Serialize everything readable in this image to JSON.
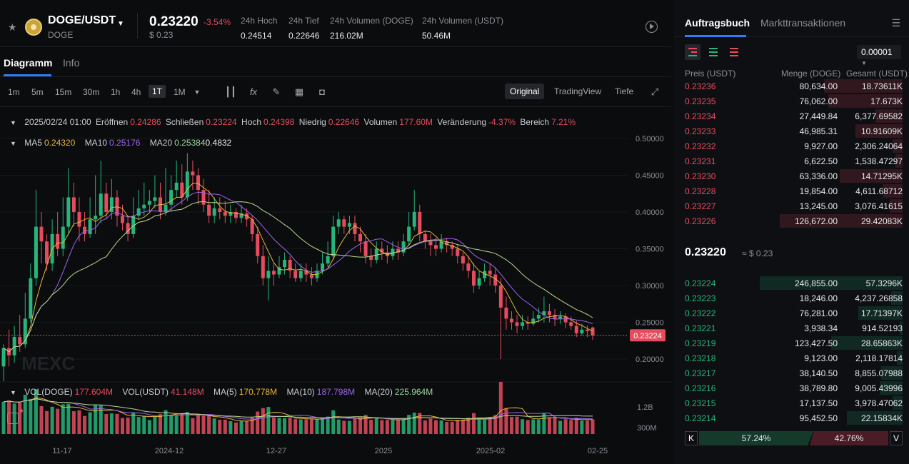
{
  "header": {
    "pair": "DOGE/USDT",
    "base": "DOGE",
    "price": "0.23220",
    "change": "-3.54%",
    "price_usd": "$ 0.23",
    "stats": [
      {
        "label": "24h Hoch",
        "value": "0.24514"
      },
      {
        "label": "24h Tief",
        "value": "0.22646"
      },
      {
        "label": "24h Volumen (DOGE)",
        "value": "216.02M"
      },
      {
        "label": "24h Volumen (USDT)",
        "value": "50.46M"
      }
    ]
  },
  "tabs": [
    {
      "label": "Diagramm"
    },
    {
      "label": "Info"
    }
  ],
  "toolbar": {
    "timeframes": [
      "1m",
      "5m",
      "15m",
      "30m",
      "1h",
      "4h",
      "1T",
      "1M"
    ],
    "active_timeframe": "1T",
    "views": [
      "Original",
      "TradingView",
      "Tiefe"
    ]
  },
  "ohlc": {
    "date": "2025/02/24 01:00",
    "open_label": "Eröffnen",
    "open": "0.24286",
    "close_label": "Schließen",
    "close": "0.23224",
    "high_label": "Hoch",
    "high": "0.24398",
    "low_label": "Niedrig",
    "low": "0.22646",
    "volume_label": "Volumen",
    "volume": "177.60M",
    "change_label": "Veränderung",
    "change": "-4.37%",
    "range_label": "Bereich",
    "range": "7.21%"
  },
  "ma": {
    "ma5_label": "MA5",
    "ma5": "0.24320",
    "ma10_label": "MA10",
    "ma10": "0.25176",
    "ma20_label": "MA20",
    "ma20": "0.25384",
    "overlap": "0.4832"
  },
  "vol": {
    "doge_label": "VOL(DOGE)",
    "doge": "177.604M",
    "usdt_label": "VOL(USDT)",
    "usdt": "41.148M",
    "ma5_label": "MA(5)",
    "ma5": "170.778M",
    "ma10_label": "MA(10)",
    "ma10": "187.798M",
    "ma20_label": "MA(20)",
    "ma20": "225.964M"
  },
  "chart_data": {
    "type": "candlestick",
    "y_ticks": [
      "0.50000",
      "0.45000",
      "0.40000",
      "0.35000",
      "0.30000",
      "0.25000",
      "0.20000"
    ],
    "ylim": [
      0.18,
      0.52
    ],
    "vol_ticks": [
      "1.2B",
      "300M"
    ],
    "x_ticks": [
      "11-17",
      "2024-12",
      "12-27",
      "2025",
      "2025-02",
      "02-25"
    ],
    "last_price": "0.23224",
    "watermark": "MEXC",
    "candles": [
      [
        0.19,
        0.215,
        0.17,
        0.22
      ],
      [
        0.215,
        0.205,
        0.19,
        0.24
      ],
      [
        0.205,
        0.23,
        0.195,
        0.245
      ],
      [
        0.23,
        0.22,
        0.21,
        0.26
      ],
      [
        0.22,
        0.255,
        0.215,
        0.29
      ],
      [
        0.255,
        0.31,
        0.25,
        0.33
      ],
      [
        0.31,
        0.38,
        0.3,
        0.43
      ],
      [
        0.38,
        0.36,
        0.33,
        0.4
      ],
      [
        0.36,
        0.33,
        0.32,
        0.37
      ],
      [
        0.33,
        0.37,
        0.32,
        0.39
      ],
      [
        0.37,
        0.35,
        0.34,
        0.4
      ],
      [
        0.35,
        0.38,
        0.34,
        0.42
      ],
      [
        0.38,
        0.42,
        0.37,
        0.46
      ],
      [
        0.42,
        0.4,
        0.38,
        0.44
      ],
      [
        0.4,
        0.38,
        0.36,
        0.42
      ],
      [
        0.38,
        0.37,
        0.36,
        0.4
      ],
      [
        0.37,
        0.39,
        0.365,
        0.42
      ],
      [
        0.39,
        0.395,
        0.37,
        0.45
      ],
      [
        0.395,
        0.425,
        0.385,
        0.47
      ],
      [
        0.425,
        0.4,
        0.39,
        0.44
      ],
      [
        0.4,
        0.42,
        0.39,
        0.445
      ],
      [
        0.42,
        0.395,
        0.38,
        0.43
      ],
      [
        0.395,
        0.385,
        0.375,
        0.41
      ],
      [
        0.385,
        0.37,
        0.36,
        0.395
      ],
      [
        0.37,
        0.395,
        0.365,
        0.42
      ],
      [
        0.395,
        0.405,
        0.39,
        0.43
      ],
      [
        0.405,
        0.41,
        0.395,
        0.44
      ],
      [
        0.41,
        0.415,
        0.4,
        0.43
      ],
      [
        0.415,
        0.42,
        0.405,
        0.45
      ],
      [
        0.42,
        0.4,
        0.39,
        0.44
      ],
      [
        0.4,
        0.41,
        0.395,
        0.46
      ],
      [
        0.41,
        0.43,
        0.4,
        0.45
      ],
      [
        0.43,
        0.44,
        0.42,
        0.47
      ],
      [
        0.44,
        0.42,
        0.41,
        0.465
      ],
      [
        0.42,
        0.455,
        0.415,
        0.48
      ],
      [
        0.455,
        0.45,
        0.43,
        0.47
      ],
      [
        0.45,
        0.43,
        0.41,
        0.46
      ],
      [
        0.43,
        0.41,
        0.4,
        0.445
      ],
      [
        0.41,
        0.395,
        0.385,
        0.43
      ],
      [
        0.395,
        0.405,
        0.385,
        0.42
      ],
      [
        0.405,
        0.4,
        0.39,
        0.42
      ],
      [
        0.4,
        0.395,
        0.385,
        0.415
      ],
      [
        0.395,
        0.4,
        0.385,
        0.41
      ],
      [
        0.4,
        0.392,
        0.385,
        0.405
      ],
      [
        0.392,
        0.398,
        0.385,
        0.41
      ],
      [
        0.398,
        0.39,
        0.38,
        0.405
      ],
      [
        0.39,
        0.37,
        0.36,
        0.395
      ],
      [
        0.37,
        0.34,
        0.33,
        0.38
      ],
      [
        0.34,
        0.31,
        0.3,
        0.355
      ],
      [
        0.31,
        0.32,
        0.28,
        0.34
      ],
      [
        0.32,
        0.315,
        0.3,
        0.33
      ],
      [
        0.315,
        0.325,
        0.31,
        0.34
      ],
      [
        0.325,
        0.335,
        0.315,
        0.345
      ],
      [
        0.335,
        0.32,
        0.31,
        0.34
      ],
      [
        0.32,
        0.31,
        0.305,
        0.33
      ],
      [
        0.31,
        0.32,
        0.305,
        0.33
      ],
      [
        0.32,
        0.315,
        0.305,
        0.33
      ],
      [
        0.315,
        0.31,
        0.3,
        0.325
      ],
      [
        0.31,
        0.32,
        0.305,
        0.33
      ],
      [
        0.32,
        0.33,
        0.315,
        0.345
      ],
      [
        0.33,
        0.34,
        0.325,
        0.36
      ],
      [
        0.34,
        0.38,
        0.335,
        0.395
      ],
      [
        0.38,
        0.39,
        0.37,
        0.4
      ],
      [
        0.39,
        0.38,
        0.37,
        0.395
      ],
      [
        0.38,
        0.385,
        0.37,
        0.395
      ],
      [
        0.385,
        0.37,
        0.36,
        0.395
      ],
      [
        0.37,
        0.36,
        0.345,
        0.38
      ],
      [
        0.36,
        0.34,
        0.33,
        0.37
      ],
      [
        0.34,
        0.335,
        0.325,
        0.35
      ],
      [
        0.335,
        0.35,
        0.33,
        0.36
      ],
      [
        0.35,
        0.345,
        0.335,
        0.36
      ],
      [
        0.345,
        0.34,
        0.33,
        0.355
      ],
      [
        0.34,
        0.35,
        0.335,
        0.36
      ],
      [
        0.35,
        0.345,
        0.335,
        0.36
      ],
      [
        0.345,
        0.36,
        0.34,
        0.37
      ],
      [
        0.36,
        0.38,
        0.355,
        0.4
      ],
      [
        0.38,
        0.4,
        0.375,
        0.43
      ],
      [
        0.4,
        0.37,
        0.36,
        0.41
      ],
      [
        0.37,
        0.36,
        0.35,
        0.375
      ],
      [
        0.36,
        0.355,
        0.34,
        0.37
      ],
      [
        0.355,
        0.35,
        0.34,
        0.365
      ],
      [
        0.35,
        0.36,
        0.345,
        0.37
      ],
      [
        0.36,
        0.355,
        0.345,
        0.365
      ],
      [
        0.355,
        0.35,
        0.34,
        0.36
      ],
      [
        0.35,
        0.34,
        0.33,
        0.355
      ],
      [
        0.34,
        0.33,
        0.32,
        0.345
      ],
      [
        0.33,
        0.32,
        0.31,
        0.34
      ],
      [
        0.32,
        0.3,
        0.29,
        0.33
      ],
      [
        0.3,
        0.31,
        0.295,
        0.32
      ],
      [
        0.31,
        0.32,
        0.305,
        0.33
      ],
      [
        0.32,
        0.315,
        0.3,
        0.33
      ],
      [
        0.315,
        0.3,
        0.29,
        0.325
      ],
      [
        0.3,
        0.27,
        0.2,
        0.31
      ],
      [
        0.27,
        0.255,
        0.24,
        0.285
      ],
      [
        0.255,
        0.25,
        0.24,
        0.265
      ],
      [
        0.25,
        0.245,
        0.235,
        0.26
      ],
      [
        0.245,
        0.25,
        0.24,
        0.26
      ],
      [
        0.25,
        0.248,
        0.24,
        0.258
      ],
      [
        0.248,
        0.255,
        0.245,
        0.265
      ],
      [
        0.255,
        0.26,
        0.25,
        0.27
      ],
      [
        0.26,
        0.265,
        0.25,
        0.285
      ],
      [
        0.265,
        0.26,
        0.25,
        0.275
      ],
      [
        0.26,
        0.255,
        0.245,
        0.268
      ],
      [
        0.255,
        0.258,
        0.248,
        0.265
      ],
      [
        0.258,
        0.25,
        0.242,
        0.262
      ],
      [
        0.25,
        0.245,
        0.24,
        0.258
      ],
      [
        0.245,
        0.235,
        0.23,
        0.252
      ],
      [
        0.235,
        0.24,
        0.232,
        0.248
      ],
      [
        0.24,
        0.238,
        0.23,
        0.246
      ],
      [
        0.243,
        0.232,
        0.226,
        0.244
      ]
    ]
  },
  "orderbook": {
    "tabs": [
      "Auftragsbuch",
      "Markttransaktionen"
    ],
    "precision": "0.00001",
    "col_price": "Preis (USDT)",
    "col_qty": "Menge (DOGE)",
    "col_total": "Gesamt (USDT)",
    "asks": [
      {
        "p": "0.23236",
        "q": "80,634.00",
        "t": "18.73611K",
        "d": 0.55
      },
      {
        "p": "0.23235",
        "q": "76,062.00",
        "t": "17.673K",
        "d": 0.52
      },
      {
        "p": "0.23234",
        "q": "27,449.84",
        "t": "6,377.69582",
        "d": 0.19
      },
      {
        "p": "0.23233",
        "q": "46,985.31",
        "t": "10.91609K",
        "d": 0.33
      },
      {
        "p": "0.23232",
        "q": "9,927.00",
        "t": "2,306.24064",
        "d": 0.07
      },
      {
        "p": "0.23231",
        "q": "6,622.50",
        "t": "1,538.47297",
        "d": 0.05
      },
      {
        "p": "0.23230",
        "q": "63,336.00",
        "t": "14.71295K",
        "d": 0.44
      },
      {
        "p": "0.23228",
        "q": "19,854.00",
        "t": "4,611.68712",
        "d": 0.14
      },
      {
        "p": "0.23227",
        "q": "13,245.00",
        "t": "3,076.41615",
        "d": 0.09
      },
      {
        "p": "0.23226",
        "q": "126,672.00",
        "t": "29.42083K",
        "d": 0.86
      }
    ],
    "mid_price": "0.23220",
    "mid_usd": "≈ $ 0.23",
    "bids": [
      {
        "p": "0.23224",
        "q": "246,855.00",
        "t": "57.3296K",
        "d": 1.0
      },
      {
        "p": "0.23223",
        "q": "18,246.00",
        "t": "4,237.26858",
        "d": 0.08
      },
      {
        "p": "0.23222",
        "q": "76,281.00",
        "t": "17.71397K",
        "d": 0.31
      },
      {
        "p": "0.23221",
        "q": "3,938.34",
        "t": "914.52193",
        "d": 0.02
      },
      {
        "p": "0.23219",
        "q": "123,427.50",
        "t": "28.65863K",
        "d": 0.5
      },
      {
        "p": "0.23218",
        "q": "9,123.00",
        "t": "2,118.17814",
        "d": 0.04
      },
      {
        "p": "0.23217",
        "q": "38,140.50",
        "t": "8,855.07988",
        "d": 0.15
      },
      {
        "p": "0.23216",
        "q": "38,789.80",
        "t": "9,005.43996",
        "d": 0.16
      },
      {
        "p": "0.23215",
        "q": "17,137.50",
        "t": "3,978.47062",
        "d": 0.07
      },
      {
        "p": "0.23214",
        "q": "95,452.50",
        "t": "22.15834K",
        "d": 0.39
      }
    ],
    "buy_ratio": "57.24%",
    "sell_ratio": "42.76%",
    "buy_letter": "K",
    "sell_letter": "V"
  },
  "colors": {
    "up": "#26b57a",
    "down": "#e54d5e",
    "ma5": "#e9b638",
    "ma10": "#9d64ef",
    "ma20": "#b8d98f"
  }
}
